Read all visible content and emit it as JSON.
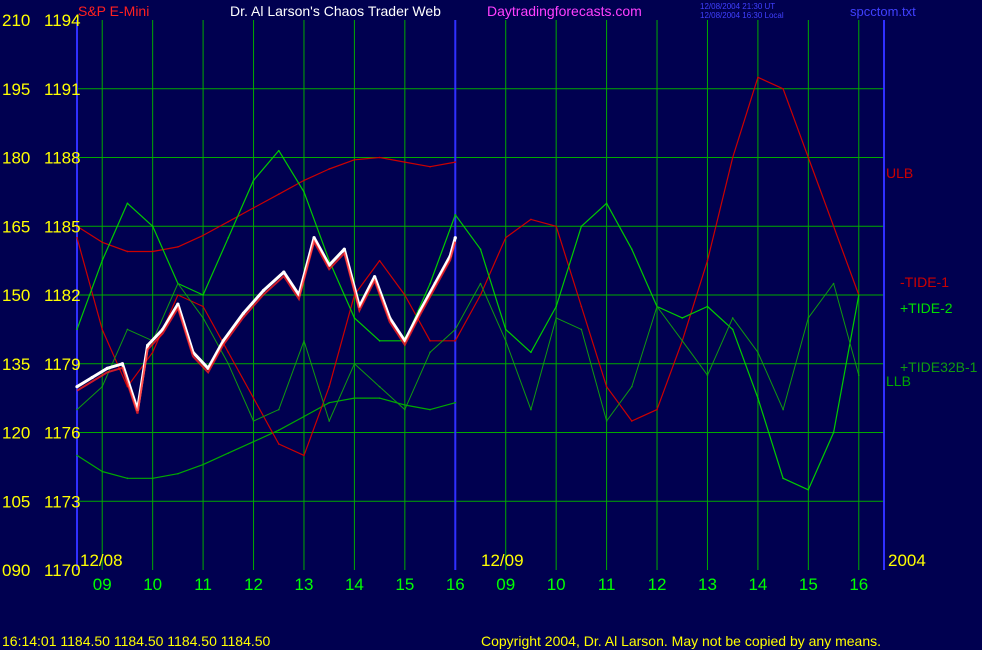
{
  "header": {
    "instrument": "S&P E-Mini",
    "title": "Dr. Al Larson's Chaos Trader Web",
    "site": "Daytradingforecasts.com",
    "stamp_line1": "12/08/2004 21:30 UT",
    "stamp_line2": "12/08/2004 16:30 Local",
    "file": "spcctom.txt"
  },
  "footer": {
    "quote": "16:14:01  1184.50 1184.50 1184.50 1184.50",
    "copyright": "Copyright 2004, Dr. Al Larson. May not be copied by any means."
  },
  "colors": {
    "background": "#000050",
    "grid": "#00aa00",
    "axis_label": "#ffff00",
    "time_label": "#00ff00",
    "ulb": "#cc0000",
    "llb": "#00aa00",
    "divider": "#3030ff"
  },
  "chart_data": {
    "type": "line",
    "title": "Dr. Al Larson's Chaos Trader Web",
    "left_scale_ticks": [
      "210",
      "195",
      "180",
      "165",
      "150",
      "135",
      "120",
      "105",
      "090"
    ],
    "price_ticks": [
      "1194",
      "1191",
      "1188",
      "1185",
      "1182",
      "1179",
      "1176",
      "1173",
      "1170"
    ],
    "ylim": [
      1170,
      1194
    ],
    "date_labels": [
      "12/08",
      "12/09",
      "2004"
    ],
    "x_tick_labels": [
      "09",
      "10",
      "11",
      "12",
      "13",
      "14",
      "15",
      "16",
      "09",
      "10",
      "11",
      "12",
      "13",
      "14",
      "15",
      "16"
    ],
    "divider_label": "12/09",
    "series_labels": [
      "ULB",
      "-TIDE-1",
      "+TIDE-2",
      "+TIDE32B-1",
      "LLB"
    ],
    "series": [
      {
        "name": "ULB",
        "x": [
          8.5,
          9.0,
          9.5,
          10.0,
          10.5,
          11.0,
          11.5,
          12.0,
          12.5,
          13.0,
          13.5,
          14.0,
          14.5,
          15.0,
          15.5,
          16.0
        ],
        "values": [
          1185.0,
          1184.3,
          1183.9,
          1183.9,
          1184.1,
          1184.6,
          1185.2,
          1185.8,
          1186.4,
          1187.0,
          1187.5,
          1187.9,
          1188.0,
          1187.8,
          1187.6,
          1187.8
        ]
      },
      {
        "name": "LLB",
        "x": [
          8.5,
          9.0,
          9.5,
          10.0,
          10.5,
          11.0,
          11.5,
          12.0,
          12.5,
          13.0,
          13.5,
          14.0,
          14.5,
          15.0,
          15.5,
          16.0
        ],
        "values": [
          1175.0,
          1174.3,
          1174.0,
          1174.0,
          1174.2,
          1174.6,
          1175.1,
          1175.6,
          1176.1,
          1176.7,
          1177.3,
          1177.5,
          1177.5,
          1177.2,
          1177.0,
          1177.3
        ]
      },
      {
        "name": "-TIDE-1",
        "x": [
          8.5,
          9.0,
          9.5,
          10.0,
          10.5,
          11.0,
          11.5,
          12.0,
          12.5,
          13.0,
          13.5,
          14.0,
          14.5,
          15.0,
          15.5,
          16.0,
          16.5,
          17.0,
          17.5,
          18.0,
          18.5,
          19.0,
          19.5,
          20.0,
          20.5,
          21.0,
          21.5,
          22.0,
          22.5,
          23.0,
          23.5,
          24.0
        ],
        "values": [
          1184.5,
          1180.5,
          1178.0,
          1179.5,
          1182.0,
          1181.5,
          1179.5,
          1177.5,
          1175.5,
          1175.0,
          1178.0,
          1182.0,
          1183.5,
          1182.0,
          1180.0,
          1180.0,
          1182.0,
          1184.5,
          1185.3,
          1185.0,
          1181.5,
          1178.0,
          1176.5,
          1177.0,
          1180.0,
          1183.5,
          1188.0,
          1191.5,
          1191.0,
          1188.0,
          1185.0,
          1182.0
        ]
      },
      {
        "name": "+TIDE-2",
        "x": [
          8.5,
          9.0,
          9.5,
          10.0,
          10.5,
          11.0,
          11.5,
          12.0,
          12.5,
          13.0,
          13.5,
          14.0,
          14.5,
          15.0,
          15.5,
          16.0,
          16.5,
          17.0,
          17.5,
          18.0,
          18.5,
          19.0,
          19.5,
          20.0,
          20.5,
          21.0,
          21.5,
          22.0,
          22.5,
          23.0,
          23.5,
          24.0
        ],
        "values": [
          1180.5,
          1183.5,
          1186.0,
          1185.0,
          1182.5,
          1182.0,
          1184.5,
          1187.0,
          1188.3,
          1186.5,
          1183.5,
          1181.0,
          1180.0,
          1180.0,
          1182.5,
          1185.5,
          1184.0,
          1180.5,
          1179.5,
          1181.5,
          1185.0,
          1186.0,
          1184.0,
          1181.5,
          1181.0,
          1181.5,
          1180.5,
          1177.5,
          1174.0,
          1173.5,
          1176.0,
          1182.0
        ]
      },
      {
        "name": "+TIDE32B-1",
        "x": [
          8.5,
          9.0,
          9.5,
          10.0,
          10.5,
          11.0,
          11.5,
          12.0,
          12.5,
          13.0,
          13.5,
          14.0,
          14.5,
          15.0,
          15.5,
          16.0,
          16.5,
          17.0,
          17.5,
          18.0,
          18.5,
          19.0,
          19.5,
          20.0,
          20.5,
          21.0,
          21.5,
          22.0,
          22.5,
          23.0,
          23.5,
          24.0
        ],
        "values": [
          1177.0,
          1178.0,
          1180.5,
          1180.0,
          1182.5,
          1181.0,
          1179.0,
          1176.5,
          1177.0,
          1180.0,
          1176.5,
          1179.0,
          1178.0,
          1177.0,
          1179.5,
          1180.5,
          1182.5,
          1180.0,
          1177.0,
          1181.0,
          1180.5,
          1176.5,
          1178.0,
          1181.5,
          1180.0,
          1178.5,
          1181.0,
          1179.5,
          1177.0,
          1181.0,
          1182.5,
          1178.5
        ]
      },
      {
        "name": "S&P E-Mini",
        "x": [
          8.5,
          8.8,
          9.1,
          9.4,
          9.7,
          9.9,
          10.2,
          10.5,
          10.8,
          11.1,
          11.4,
          11.8,
          12.2,
          12.6,
          12.9,
          13.2,
          13.5,
          13.8,
          14.1,
          14.4,
          14.7,
          15.0,
          15.3,
          15.6,
          15.9,
          16.0
        ],
        "values": [
          1178.0,
          1178.4,
          1178.8,
          1179.0,
          1177.0,
          1179.8,
          1180.5,
          1181.6,
          1179.5,
          1178.8,
          1180.0,
          1181.2,
          1182.2,
          1183.0,
          1182.0,
          1184.5,
          1183.3,
          1184.0,
          1181.5,
          1182.8,
          1181.0,
          1180.0,
          1181.3,
          1182.5,
          1183.7,
          1184.5
        ]
      }
    ],
    "x_range": [
      8.5,
      24.5
    ],
    "grid": true
  }
}
